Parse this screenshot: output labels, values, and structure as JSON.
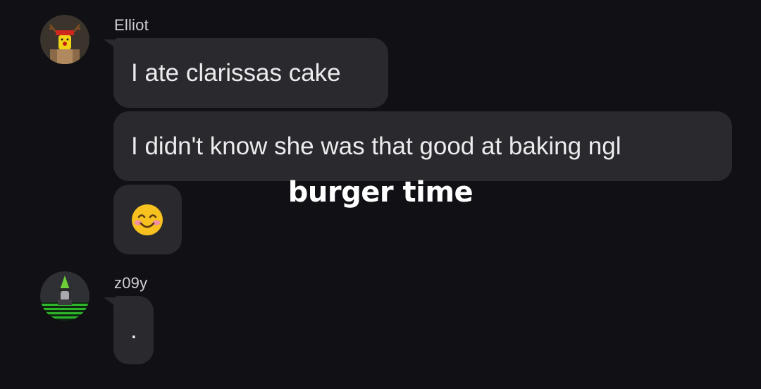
{
  "messages": [
    {
      "username": "Elliot",
      "avatar_icon": "reindeer-avatar-icon",
      "bubbles": [
        "I ate clarissas cake",
        "I didn't know she was that good at baking ngl",
        "😊"
      ]
    },
    {
      "username": "z09y",
      "avatar_icon": "wizard-avatar-icon",
      "bubbles": [
        "."
      ]
    }
  ],
  "overlay_caption": "burger time",
  "colors": {
    "background": "#111014",
    "bubble": "#2a2a2e",
    "text": "#ececef"
  }
}
